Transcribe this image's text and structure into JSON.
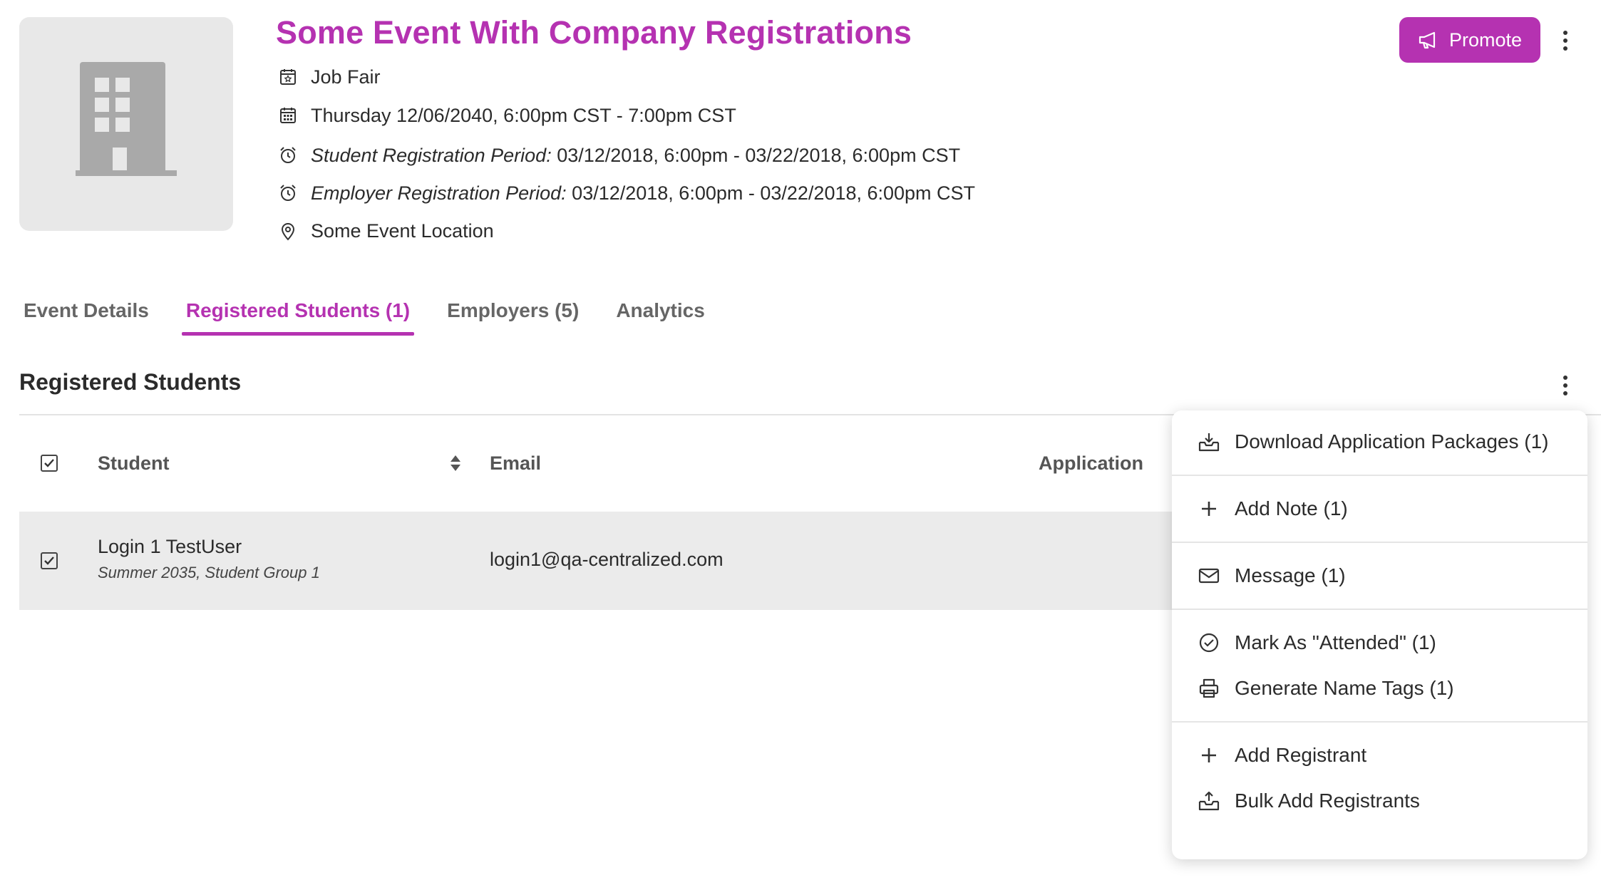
{
  "event": {
    "title": "Some Event With Company Registrations",
    "type": "Job Fair",
    "datetime": "Thursday 12/06/2040, 6:00pm CST - 7:00pm CST",
    "student_reg_label": "Student Registration Period:",
    "student_reg_value": " 03/12/2018, 6:00pm - 03/22/2018, 6:00pm CST",
    "employer_reg_label": "Employer Registration Period:",
    "employer_reg_value": " 03/12/2018, 6:00pm - 03/22/2018, 6:00pm CST",
    "location": "Some Event Location"
  },
  "header": {
    "promote_label": "Promote"
  },
  "tabs": [
    {
      "label": "Event Details",
      "active": false
    },
    {
      "label": "Registered Students (1)",
      "active": true
    },
    {
      "label": "Employers (5)",
      "active": false
    },
    {
      "label": "Analytics",
      "active": false
    }
  ],
  "section": {
    "title": "Registered Students"
  },
  "table": {
    "columns": {
      "student": "Student",
      "email": "Email",
      "application": "Application"
    },
    "rows": [
      {
        "name": "Login 1 TestUser",
        "detail": "Summer 2035, Student Group 1",
        "email": "login1@qa-centralized.com",
        "checked": true
      }
    ]
  },
  "menu": {
    "download": "Download Application Packages (1)",
    "add_note": "Add Note (1)",
    "message": "Message (1)",
    "mark_attended": "Mark As \"Attended\" (1)",
    "name_tags": "Generate Name Tags (1)",
    "add_registrant": "Add Registrant",
    "bulk_add": "Bulk Add Registrants"
  },
  "colors": {
    "accent": "#b532b1",
    "row_bg": "#ebebeb",
    "thumb_bg": "#e8e8e8"
  },
  "icons": [
    "building-icon",
    "calendar-star-icon",
    "calendar-icon",
    "alarm-icon",
    "location-pin-icon",
    "megaphone-icon",
    "kebab-icon",
    "checkbox-icon",
    "sort-icon",
    "download-tray-icon",
    "plus-icon",
    "envelope-icon",
    "check-circle-icon",
    "printer-icon",
    "upload-tray-icon"
  ]
}
